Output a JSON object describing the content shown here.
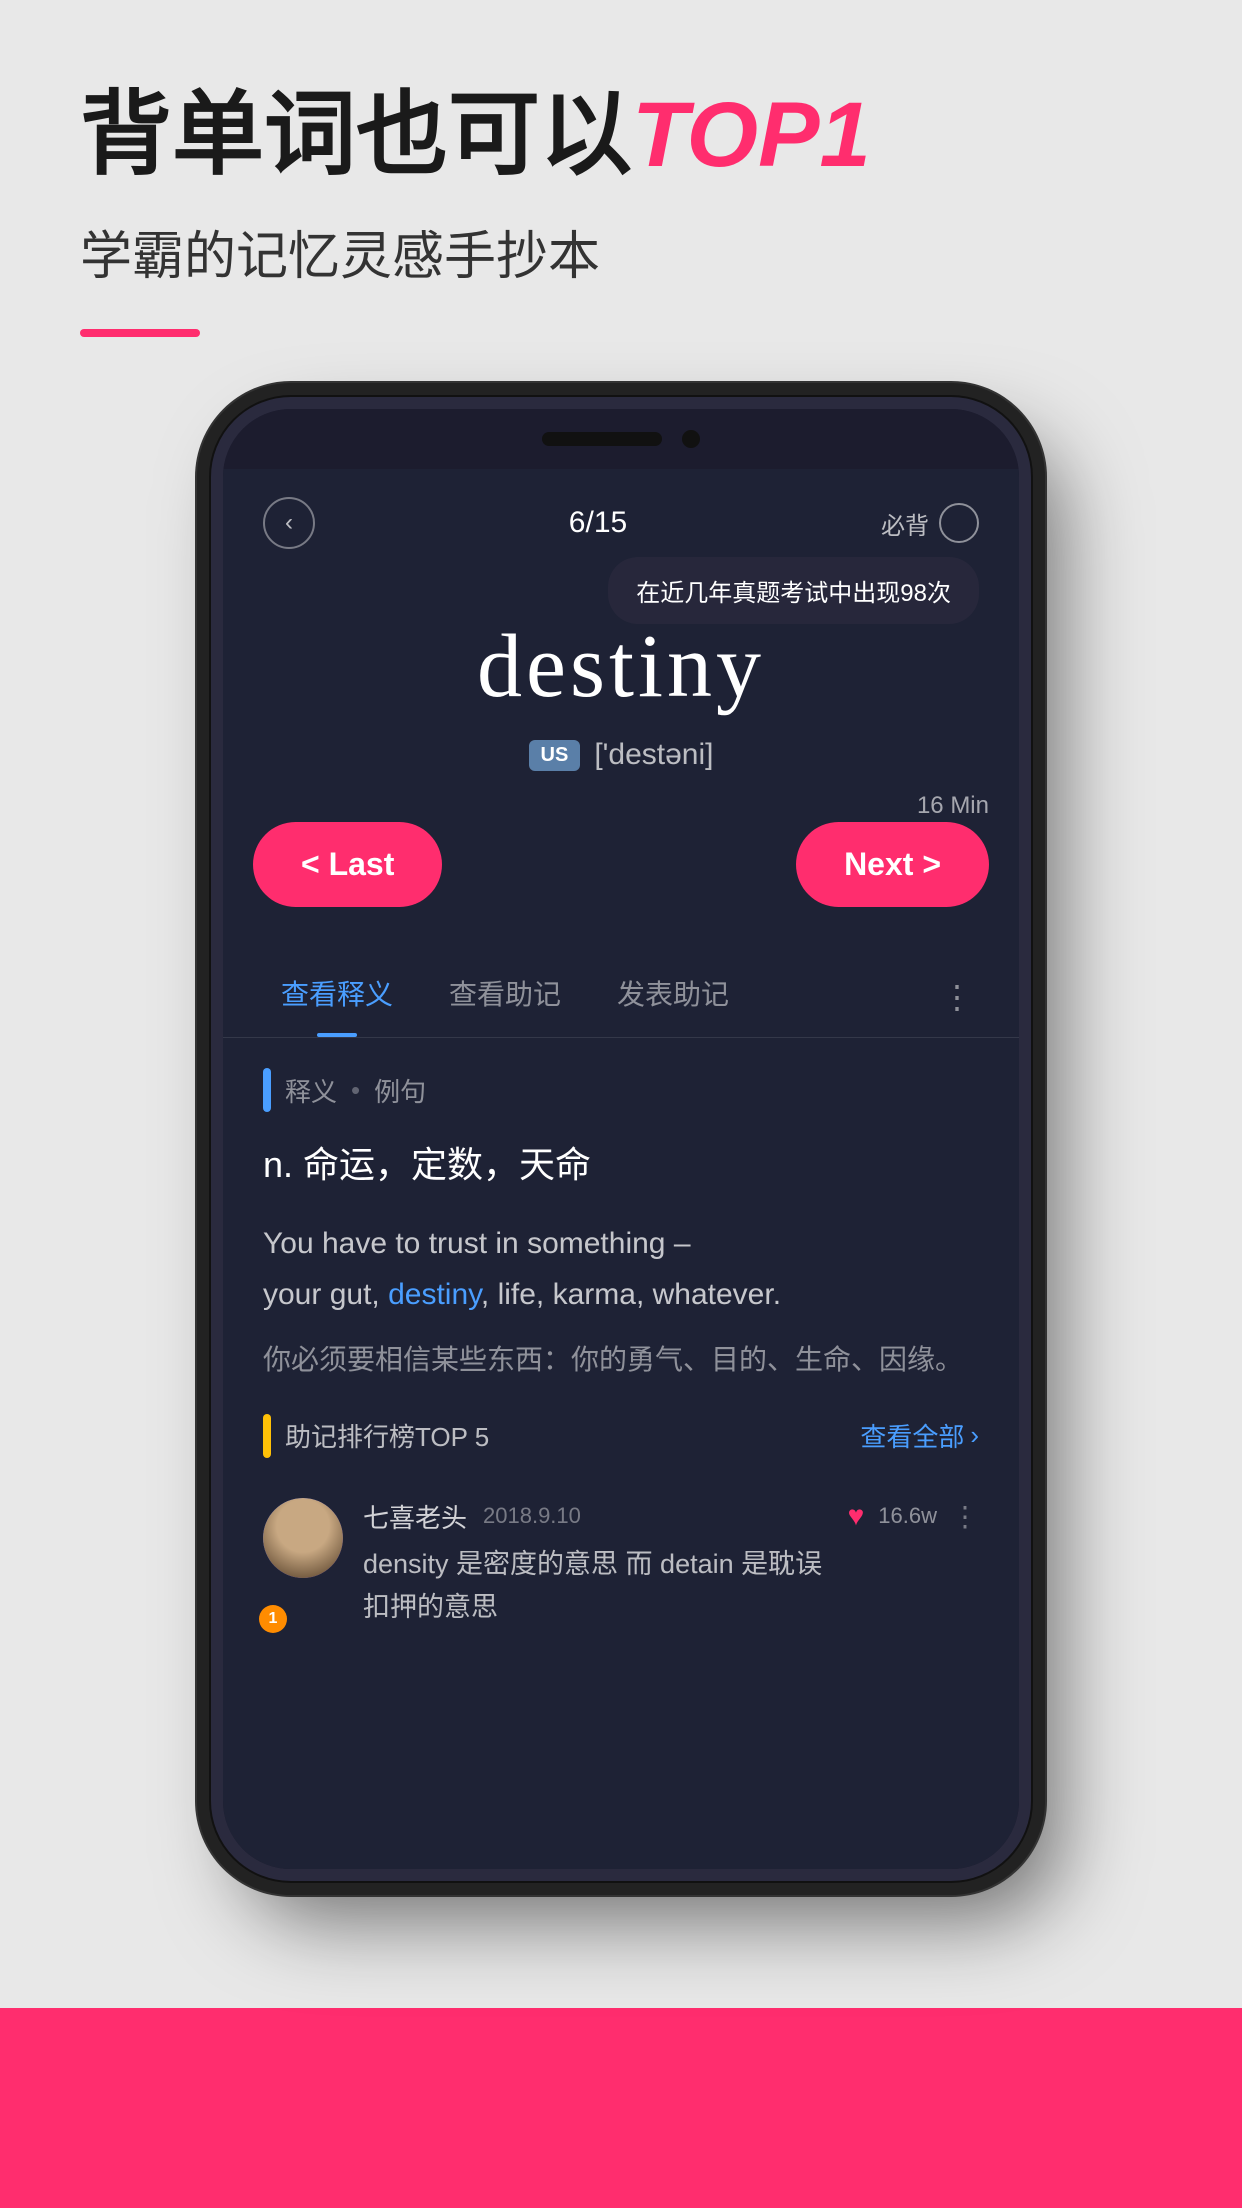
{
  "page": {
    "background_color": "#e8e8e8"
  },
  "header": {
    "main_title_part1": "背单词也可以",
    "main_title_highlight": "TOP1",
    "sub_title": "学霸的记忆灵感手抄本",
    "accent_color": "#ff2d6e"
  },
  "phone": {
    "nav": {
      "back_icon": "‹",
      "progress": "6/15",
      "must_remember_label": "必背",
      "tooltip": "在近几年真题考试中出现98次"
    },
    "word": {
      "main": "destiny",
      "phonetic_badge": "US",
      "phonetic": "['destəni]"
    },
    "controls": {
      "time": "16 Min",
      "last_btn": "< Last",
      "next_btn": "Next >"
    },
    "tabs": [
      {
        "label": "查看释义",
        "active": true
      },
      {
        "label": "查看助记",
        "active": false
      },
      {
        "label": "发表助记",
        "active": false
      }
    ],
    "tab_more": "⋮",
    "definition_section": {
      "header_label": "释义",
      "header_dot": "•",
      "header_example": "例句",
      "definition_cn": "n.  命运，定数，天命",
      "example_en_part1": "You have to trust in something –",
      "example_en_part2": "your gut, ",
      "example_en_highlight": "destiny",
      "example_en_part3": ", life, karma, whatever.",
      "example_cn": "你必须要相信某些东西：你的勇气、目的、生命、因缘。"
    },
    "mnemonic_section": {
      "title": "助记排行榜TOP 5",
      "see_all": "查看全部",
      "comment": {
        "user_name": "七喜老头",
        "date": "2018.9.10",
        "badge": "1",
        "like_count": "16.6w",
        "text_part1": "density 是密度的意思  而 detain 是耽误",
        "text_part2": "扣押的意思"
      }
    }
  }
}
